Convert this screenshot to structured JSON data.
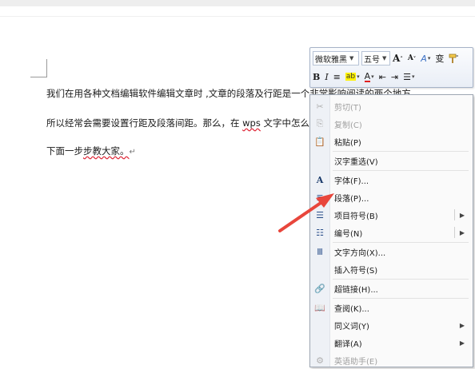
{
  "document": {
    "line1": "我们在用各种文档编辑软件编辑文章时 ,文章的段落及行距是一个非常影响阅读的两个地方。",
    "line2_before": "所以经常会需要设置行距及段落间距。那么，在 ",
    "line2_wps": "wps",
    "line2_after": " 文字中怎么设置呢？",
    "line3_a": "下面一步",
    "line3_b": "步教大家。",
    "return_mark": "↵"
  },
  "mini_toolbar": {
    "font_name": "微软雅黑",
    "font_size": "五号",
    "grow_font": "A",
    "shrink_font": "A",
    "text_effect": "A",
    "phonetic": "变",
    "format_painter_icon": "format-painter-icon",
    "bold": "B",
    "italic": "I",
    "align": "≡",
    "highlight": "ab",
    "font_color": "A",
    "indent_decrease": "⇤",
    "indent_increase": "⇥",
    "bullets": "☰"
  },
  "context_menu": {
    "items": [
      {
        "label": "剪切(T)",
        "icon": "✂",
        "disabled": true
      },
      {
        "label": "复制(C)",
        "icon": "⎘",
        "disabled": true
      },
      {
        "label": "粘贴(P)",
        "icon": "📋",
        "disabled": false
      },
      {
        "label": "汉字重选(V)",
        "icon": "",
        "disabled": false
      },
      {
        "label": "字体(F)...",
        "icon": "A",
        "disabled": false
      },
      {
        "label": "段落(P)...",
        "icon": "≣",
        "disabled": false
      },
      {
        "label": "项目符号(B)",
        "icon": "☰",
        "disabled": false,
        "submenu": true
      },
      {
        "label": "编号(N)",
        "icon": "☷",
        "disabled": false,
        "submenu": true
      },
      {
        "label": "文字方向(X)...",
        "icon": "Ⅲ",
        "disabled": false
      },
      {
        "label": "插入符号(S)",
        "icon": "",
        "disabled": false
      },
      {
        "label": "超链接(H)...",
        "icon": "🔗",
        "disabled": false
      },
      {
        "label": "查阅(K)...",
        "icon": "📖",
        "disabled": false
      },
      {
        "label": "同义词(Y)",
        "icon": "",
        "disabled": false,
        "submenu": true
      },
      {
        "label": "翻译(A)",
        "icon": "",
        "disabled": false,
        "submenu": true
      },
      {
        "label": "英语助手(E)",
        "icon": "⚙",
        "disabled": true
      }
    ]
  },
  "colors": {
    "annotation_arrow": "#e8463c",
    "font_color_bar": "#e02020",
    "highlight": "#fff200"
  }
}
